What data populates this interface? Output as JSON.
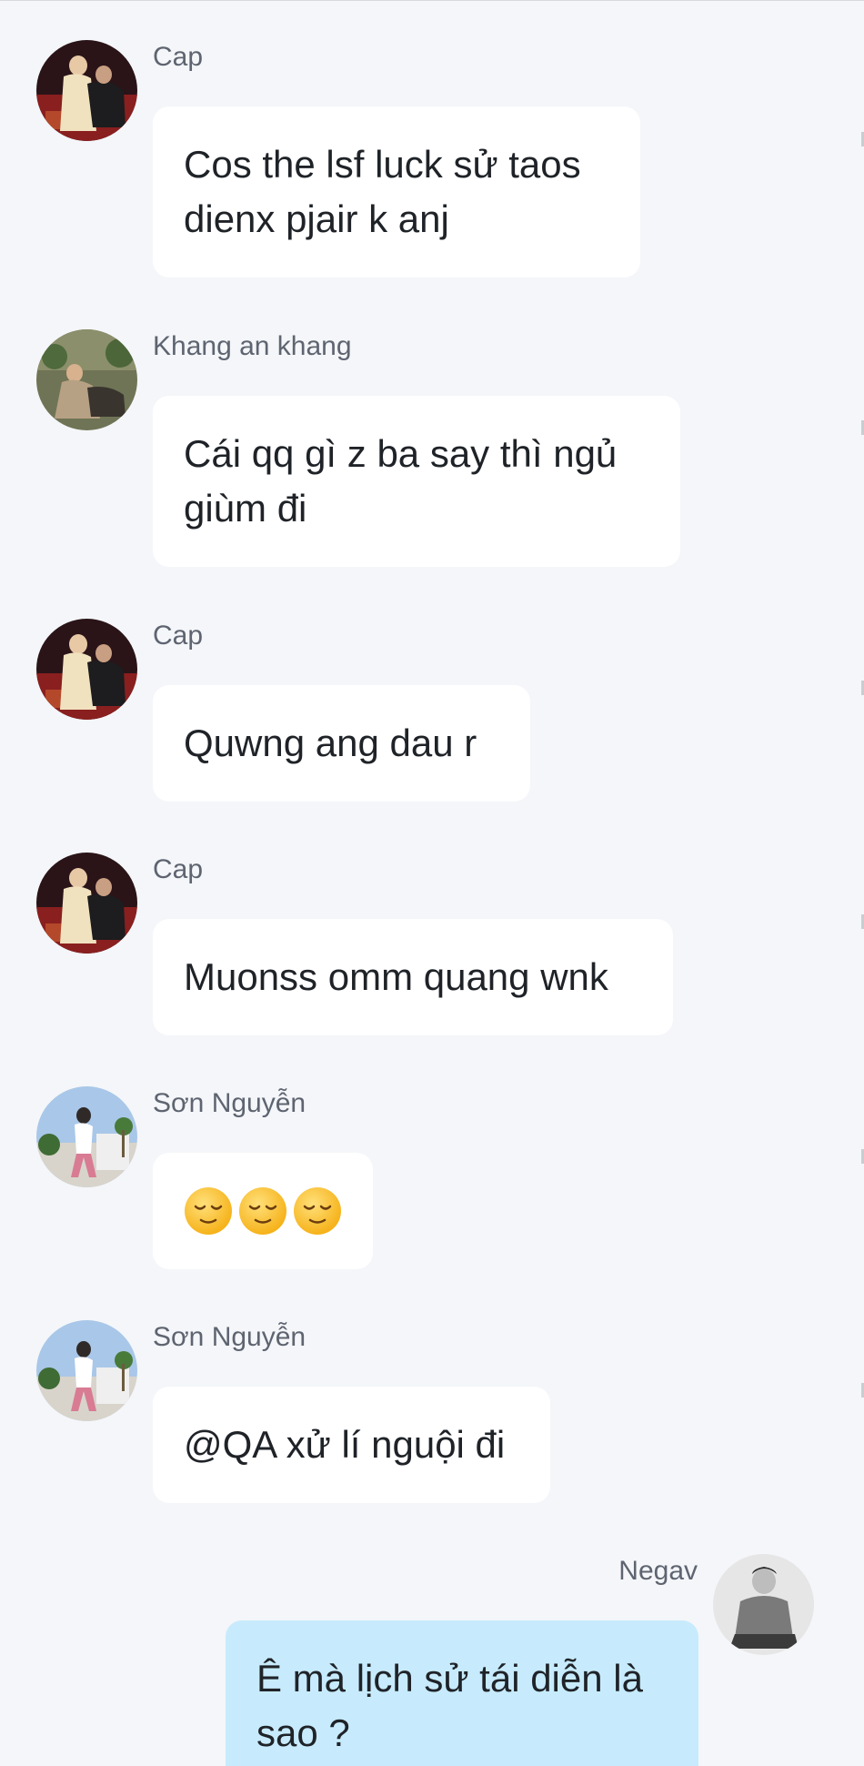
{
  "messages": [
    {
      "sender": "Cap",
      "avatar": "cap-avatar",
      "text": "Cos the lsf luck sử taos dienx pjair k anj"
    },
    {
      "sender": "Khang an khang",
      "avatar": "khang-avatar",
      "text": "Cái qq gì z ba say thì ngủ giùm đi"
    },
    {
      "sender": "Cap",
      "avatar": "cap-avatar",
      "text": "Quwng ang dau r"
    },
    {
      "sender": "Cap",
      "avatar": "cap-avatar",
      "text": "Muonss omm quang wnk"
    },
    {
      "sender": "Sơn Nguyễn",
      "avatar": "son-avatar",
      "emoji": [
        "relieved-face",
        "relieved-face",
        "relieved-face"
      ]
    },
    {
      "sender": "Sơn Nguyễn",
      "avatar": "son-avatar",
      "text": "@QA xử lí nguội đi"
    },
    {
      "sender": "Negav",
      "avatar": "negav-avatar",
      "text": "Ê mà lịch sử tái diễn là sao ?",
      "mine": true
    }
  ],
  "colors": {
    "background": "#f4f6f9",
    "bubble_incoming": "#ffffff",
    "bubble_outgoing": "#c7ebfd",
    "name_text": "#5e6470",
    "message_text": "#1f2328"
  }
}
